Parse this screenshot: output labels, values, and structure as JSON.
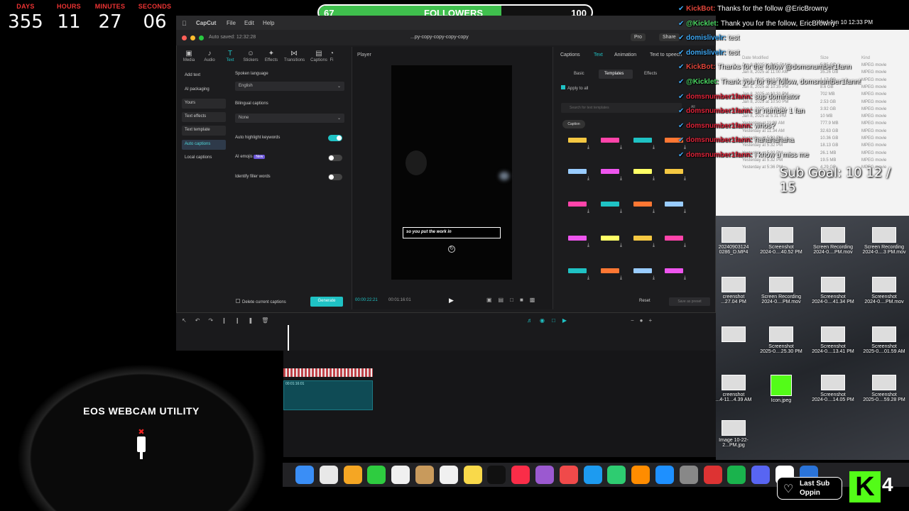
{
  "countdown": {
    "labels": [
      "DAYS",
      "HOURS",
      "MINUTES",
      "SECONDS"
    ],
    "values": [
      "355",
      "11",
      "27",
      "06"
    ]
  },
  "followers": {
    "label": "FOLLOWERS",
    "current": "67",
    "goal": "100",
    "progress": 0.67
  },
  "capcut": {
    "menu": [
      "CapCut",
      "File",
      "Edit",
      "Help"
    ],
    "autosave": "Auto saved: 12:32:28",
    "project": "...py-copy-copy-copy-copy",
    "pro": "Pro",
    "share": "Share",
    "toolbar": [
      "Media",
      "Audio",
      "Text",
      "Stickers",
      "Effects",
      "Transitions",
      "Captions",
      "Fi"
    ],
    "side": [
      "Add text",
      "AI packaging",
      "Yours",
      "Text effects",
      "Text template",
      "Auto captions",
      "Local captions"
    ],
    "spoken_label": "Spoken language",
    "spoken_value": "English",
    "bilingual_label": "Bilingual captions",
    "bilingual_value": "None",
    "highlight_label": "Auto highlight keywords",
    "emojis_label": "AI emojis",
    "emojis_badge": "New",
    "filler_label": "Identify filler words",
    "delete_label": "Delete current captions",
    "generate": "Generate",
    "player": "Player",
    "caption_text": "so you put the work in",
    "time_current": "00:00:22:21",
    "time_total": "00:01:16:01",
    "right_tabs": [
      "Captions",
      "Text",
      "Animation",
      "Text to speech"
    ],
    "sub_tabs": [
      "Basic",
      "Templates",
      "Effects"
    ],
    "apply_all": "Apply to all",
    "search_placeholder": "Search for text templates",
    "all": "All",
    "caption_chip": "Caption",
    "reset": "Reset",
    "save_preset": "Save as preset",
    "clip_time": "00:01:16:01"
  },
  "chat": [
    {
      "name": "KickBot",
      "msg": "Thanks for the follow @EricBrowny",
      "color": "#e0453a"
    },
    {
      "name": "@Kicklet",
      "msg": "Thank you for the follow, EricBrowny!",
      "color": "#4cd964"
    },
    {
      "name": "domislivelr",
      "msg": "test",
      "color": "#3fa9f5"
    },
    {
      "name": "domislivelr",
      "msg": "test",
      "color": "#3fa9f5"
    },
    {
      "name": "KickBot",
      "msg": "Thanks for the follow @domsnumber1fann",
      "color": "#e0453a"
    },
    {
      "name": "@Kicklet",
      "msg": "Thank you for the follow, domsnumber1fann!",
      "color": "#4cd964"
    },
    {
      "name": "domsnumber1fann",
      "msg": "sup dominator",
      "color": "#e0243a"
    },
    {
      "name": "domsnumber1fann",
      "msg": "ur number 1 fan",
      "color": "#e0243a"
    },
    {
      "name": "domsnumber1fann",
      "msg": "whos?",
      "color": "#e0243a"
    },
    {
      "name": "domsnumber1fann",
      "msg": "hahahahaha",
      "color": "#e0243a"
    },
    {
      "name": "domsnumber1fann",
      "msg": "i know u miss me",
      "color": "#e0243a"
    }
  ],
  "sub_goal": "Sub Goal: 10   12 / 15",
  "finder": {
    "clock": "Wed Jan 10 12:33 PM",
    "headers": [
      "Date Modified",
      "Size",
      "Kind"
    ],
    "rows": [
      [
        "Jan 8, 2025 at 3:15 PM",
        "5.25 GB",
        "MPEG movie"
      ],
      [
        "Jan 8, 2025 at 11:00 AM",
        "35.26 GB",
        "MPEG movie"
      ],
      [
        "Jan 8, 2025 at 10:50 AM",
        "1.17 GB",
        "MPEG movie"
      ],
      [
        "Jan 8, 2025 at 10:35 PM",
        "8.6 GB",
        "MPEG movie"
      ],
      [
        "Jan 8, 2025 at 10:31 PM",
        "702 MB",
        "MPEG movie"
      ],
      [
        "Jan 8, 2025 at 10:50 PM",
        "2.53 GB",
        "MPEG movie"
      ],
      [
        "Jan 8, 2025 at 5:31 PM",
        "3.92 GB",
        "MPEG movie"
      ],
      [
        "Jan 8, 2025 at 5:31 PM",
        "10 MB",
        "MPEG movie"
      ],
      [
        "Yesterday at 11:38 AM",
        "777.9 MB",
        "MPEG movie"
      ],
      [
        "Yesterday at 11:34 AM",
        "32.63 GB",
        "MPEG movie"
      ],
      [
        "Yesterday at 5:32 PM",
        "10.36 GB",
        "MPEG movie"
      ],
      [
        "Yesterday at 5:32 PM",
        "18.13 GB",
        "MPEG movie"
      ],
      [
        "Yesterday at 5:32 PM",
        "26.1 MB",
        "MPEG movie"
      ],
      [
        "Yesterday at 5:32 PM",
        "19.5 MB",
        "MPEG movie"
      ],
      [
        "Yesterday at 5:36 PM",
        "4.29 GB",
        "MPEG movie"
      ]
    ]
  },
  "desktop_icons": [
    {
      "name": "20240903124\n0286_D.MP4"
    },
    {
      "name": "Screenshot\n2024-0....40.52 PM"
    },
    {
      "name": "Screen Recording\n2024-0....PM.mov"
    },
    {
      "name": "Screen Recording\n2024-0....3 PM.mov"
    },
    {
      "name": "creenshot\n...27.04 PM"
    },
    {
      "name": "Screen Recording\n2024-0....PM.mov"
    },
    {
      "name": "Screenshot\n2024-0....41.34 PM"
    },
    {
      "name": "Screenshot\n2024-0....PM.mov"
    },
    {
      "name": ""
    },
    {
      "name": "Screenshot\n2025-0....25.30 PM"
    },
    {
      "name": "Screenshot\n2024-0....13.41 PM"
    },
    {
      "name": "Screenshot\n2025-0....01.59 AM"
    },
    {
      "name": "creenshot\n...4-11...4.39 AM"
    },
    {
      "name": "Icon.jpeg"
    },
    {
      "name": "Screenshot\n2024-0....14.05 PM"
    },
    {
      "name": "Screenshot\n2025-0....59.28 PM"
    },
    {
      "name": "Image 10-22-\n2...PM.jpg"
    }
  ],
  "webcam": "EOS WEBCAM UTILITY",
  "last_sub": {
    "label": "Last Sub",
    "name": "Oppin"
  },
  "kick_count": "4",
  "dock_colors": [
    "#3a8ef6",
    "#e8e8e8",
    "#f5a623",
    "#2ecc40",
    "#f0f0f0",
    "#c89a5c",
    "#f0f0f0",
    "#f9d94a",
    "#111",
    "#fa2d48",
    "#9b59d0",
    "#f04a4a",
    "#1d9bf0",
    "#2ecc71",
    "#ff8c00",
    "#1e90ff",
    "#888",
    "#d33",
    "#1ab34d",
    "#5865f2",
    "#fff",
    "#2a73d8"
  ]
}
